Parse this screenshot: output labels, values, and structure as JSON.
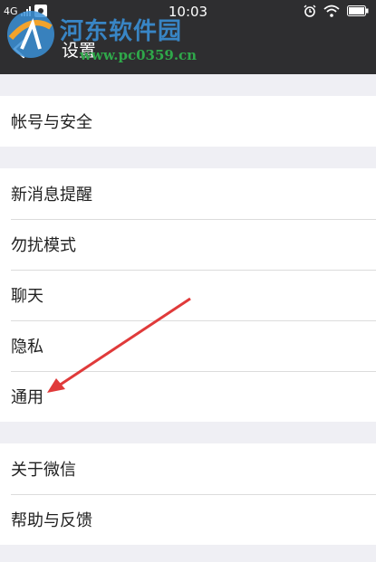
{
  "status_bar": {
    "network": "4G",
    "time": "10:03",
    "icons": [
      "signal-icon",
      "notification-icon",
      "alarm-icon",
      "wifi-icon",
      "battery-icon"
    ]
  },
  "header": {
    "title": "设置",
    "back_icon": "back-arrow-icon"
  },
  "watermark": {
    "name": "河东软件园",
    "url": "www.pc0359.cn"
  },
  "settings": {
    "groups": [
      {
        "items": [
          {
            "label": "帐号与安全"
          }
        ]
      },
      {
        "items": [
          {
            "label": "新消息提醒"
          },
          {
            "label": "勿扰模式"
          },
          {
            "label": "聊天"
          },
          {
            "label": "隐私"
          },
          {
            "label": "通用"
          }
        ]
      },
      {
        "items": [
          {
            "label": "关于微信"
          },
          {
            "label": "帮助与反馈"
          }
        ]
      }
    ]
  },
  "annotation": {
    "arrow_color": "#e03a3a"
  }
}
